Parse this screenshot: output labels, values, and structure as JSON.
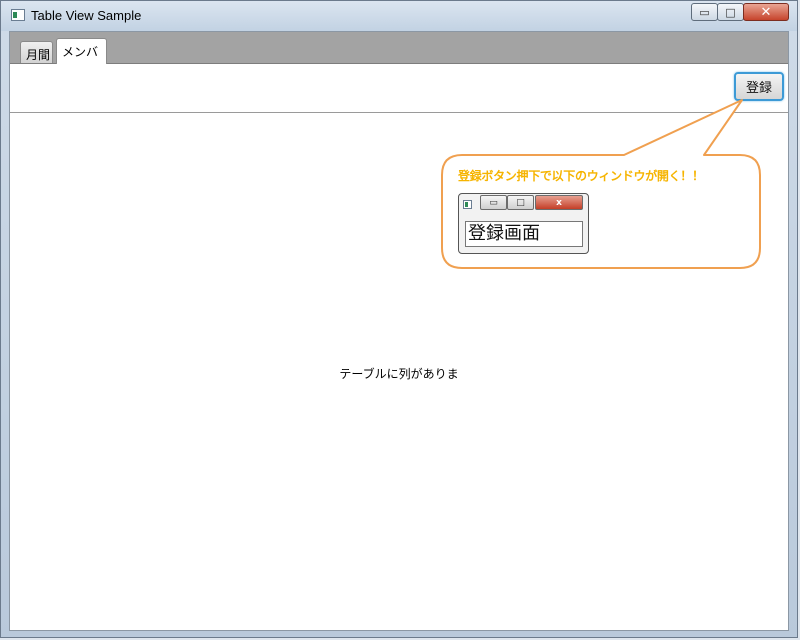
{
  "window": {
    "title": "Table View Sample",
    "min_glyph": "▭",
    "max_glyph": "□",
    "close_glyph": "✕"
  },
  "tabs": [
    {
      "label": "月間",
      "active": false
    },
    {
      "label": "メンバ",
      "active": true
    }
  ],
  "toolbar": {
    "register_label": "登録"
  },
  "table": {
    "placeholder": "テーブルに列がありま"
  },
  "annotation": {
    "text": "登録ボタン押下で以下のウィンドウが開く！！",
    "border_color": "#f0a050",
    "text_color": "#f6b400",
    "mini_window": {
      "min_glyph": "▭",
      "max_glyph": "□",
      "close_glyph": "x",
      "body_text": "登録画面"
    }
  },
  "colors": {
    "tabstrip": "#a3a3a3",
    "button_focus_border": "#3c9ad6",
    "close_button": "#c6442c"
  }
}
